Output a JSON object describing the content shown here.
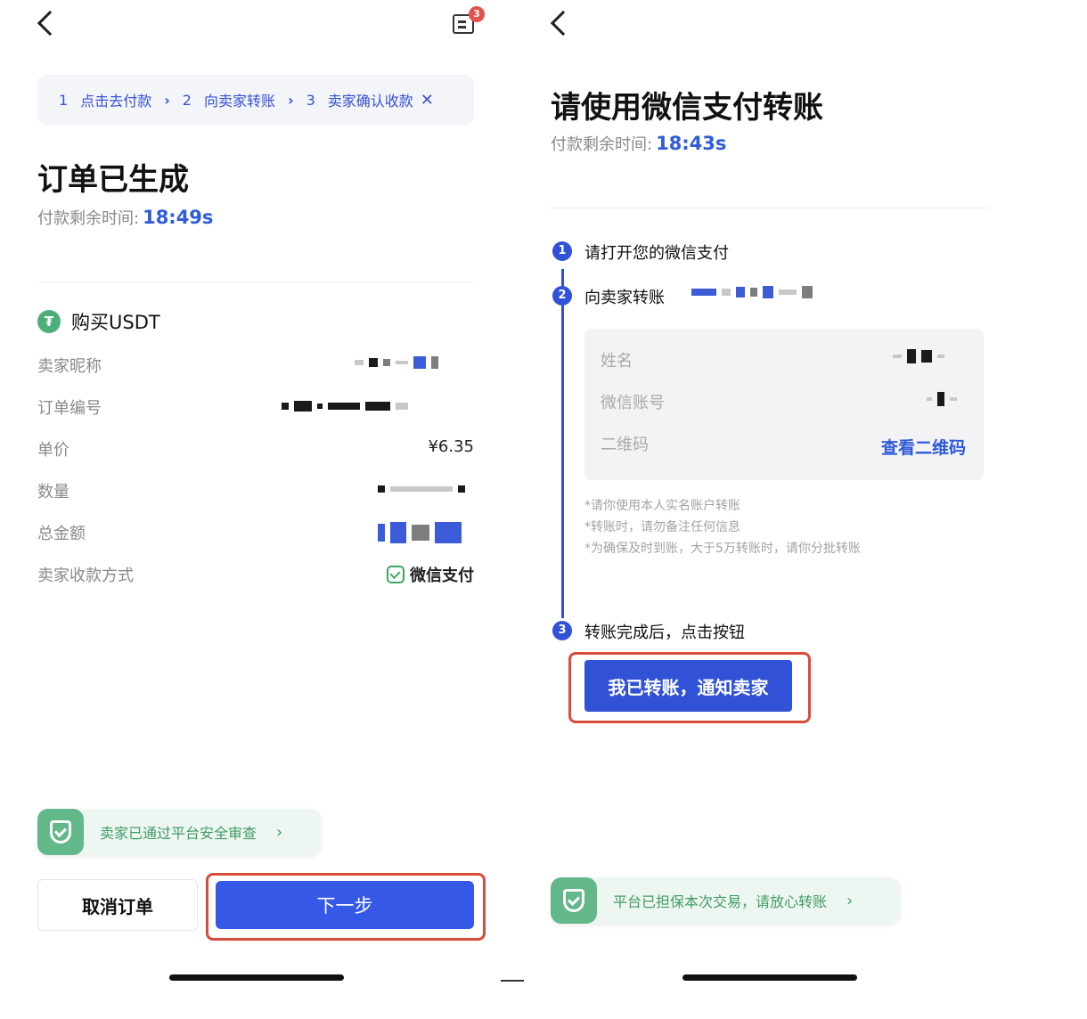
{
  "left": {
    "message_badge": "3",
    "steps": [
      {
        "num": "1",
        "label": "点击去付款"
      },
      {
        "num": "2",
        "label": "向卖家转账"
      },
      {
        "num": "3",
        "label": "卖家确认收款"
      }
    ],
    "title": "订单已生成",
    "timer_label": "付款剩余时间:",
    "timer_value": "18:49s",
    "section_title": "购买USDT",
    "rows": {
      "seller_nickname": "卖家昵称",
      "order_number": "订单编号",
      "unit_price": "单价",
      "unit_price_value": "¥6.35",
      "quantity": "数量",
      "total_amount": "总金额",
      "payment_method": "卖家收款方式",
      "payment_method_value": "微信支付"
    },
    "security_text": "卖家已通过平台安全审查",
    "cancel_label": "取消订单",
    "next_label": "下一步"
  },
  "right": {
    "title": "请使用微信支付转账",
    "timer_label": "付款剩余时间:",
    "timer_value": "18:43s",
    "step1": "请打开您的微信支付",
    "step2": "向卖家转账",
    "step3": "转账完成后，点击按钮",
    "card": {
      "name_label": "姓名",
      "wechat_label": "微信账号",
      "qr_label": "二维码",
      "qr_link": "查看二维码"
    },
    "notes": [
      "*请你使用本人实名账户转账",
      "*转账时，请勿备注任何信息",
      "*为确保及时到账，大于5万转账时，请你分批转账"
    ],
    "done_button": "我已转账，通知卖家",
    "guarantee_text": "平台已担保本次交易，请放心转账"
  },
  "colors": {
    "accent": "#3558e6",
    "highlight": "#d94b3a",
    "success": "#3f9c67"
  }
}
